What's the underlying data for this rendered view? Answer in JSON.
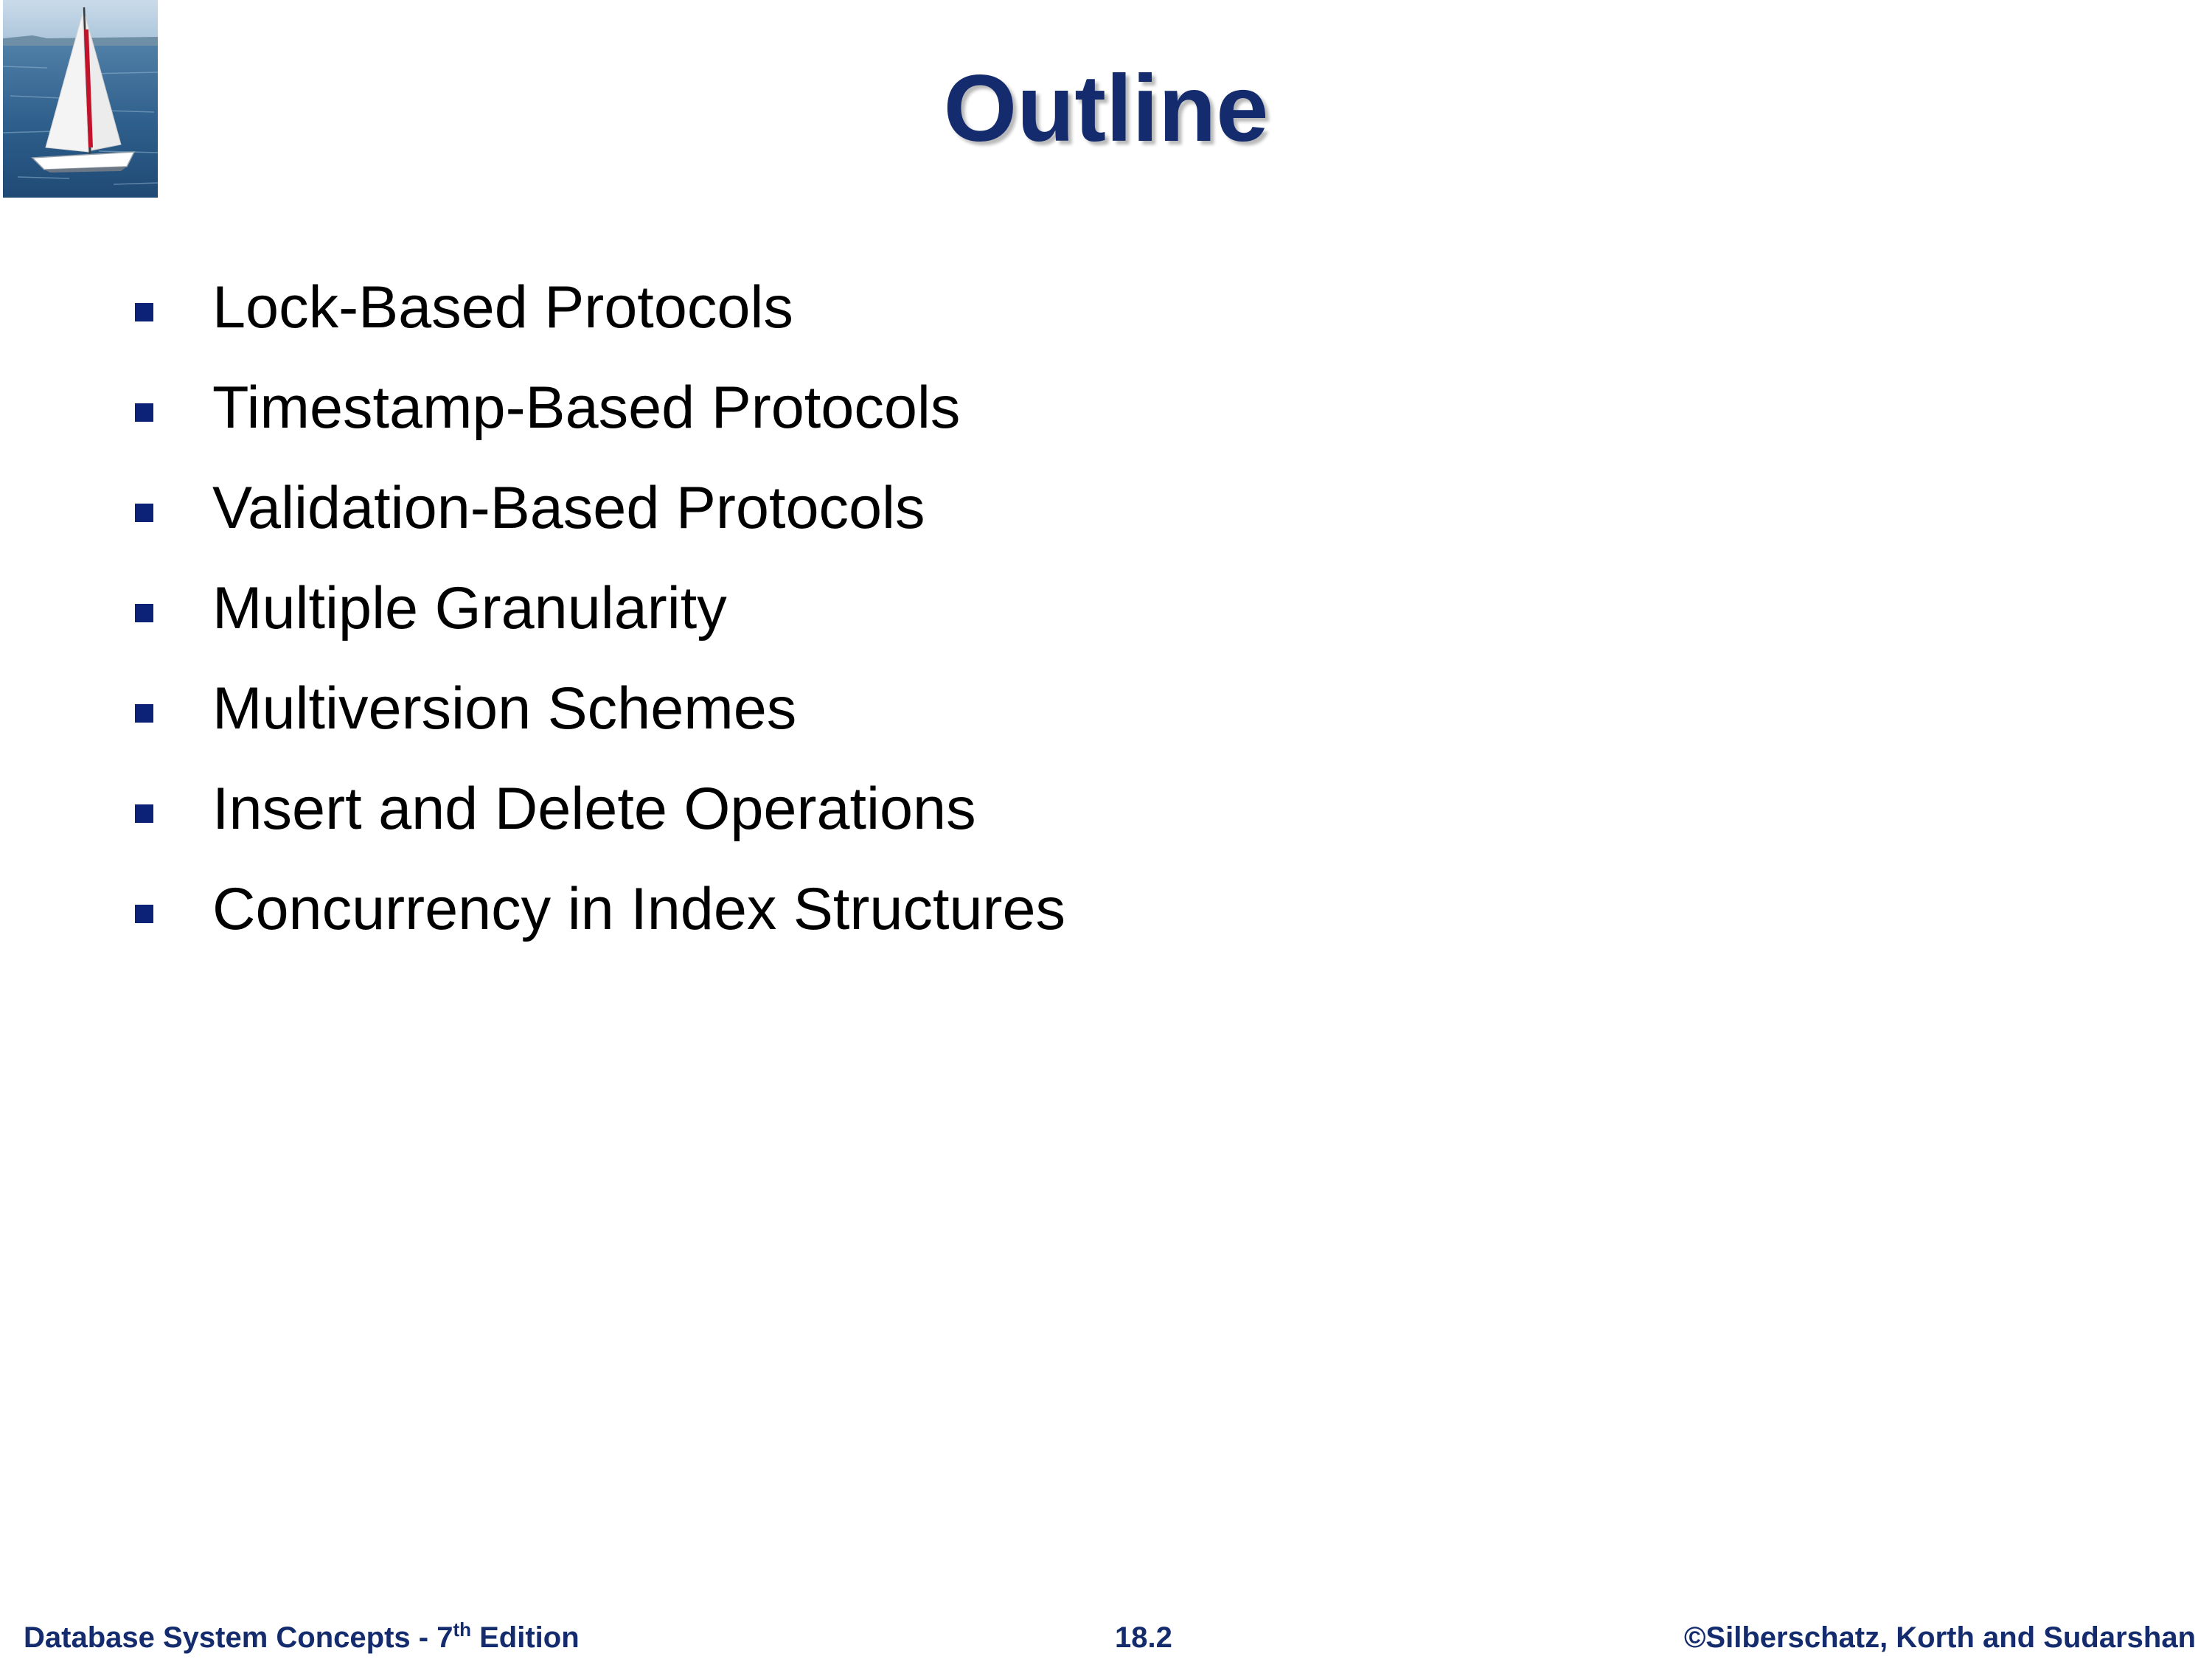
{
  "slide": {
    "title": "Outline",
    "bullets": [
      "Lock-Based Protocols",
      "Timestamp-Based Protocols",
      "Validation-Based Protocols",
      "Multiple Granularity",
      "Multiversion Schemes",
      "Insert and Delete Operations",
      "Concurrency in Index Structures"
    ]
  },
  "footer": {
    "book_title": "Database System Concepts - 7",
    "edition_superscript": "th",
    "edition_word": " Edition",
    "page_number": "18.2",
    "copyright": "©Silberschatz, Korth and Sudarshan"
  },
  "colors": {
    "title": "#142b6e",
    "bullet_marker": "#0c2277",
    "footer_text": "#142b6e",
    "body_text": "#000000"
  },
  "icons": {
    "logo": "sailboat-photo",
    "bullet": "square-bullet-icon"
  }
}
